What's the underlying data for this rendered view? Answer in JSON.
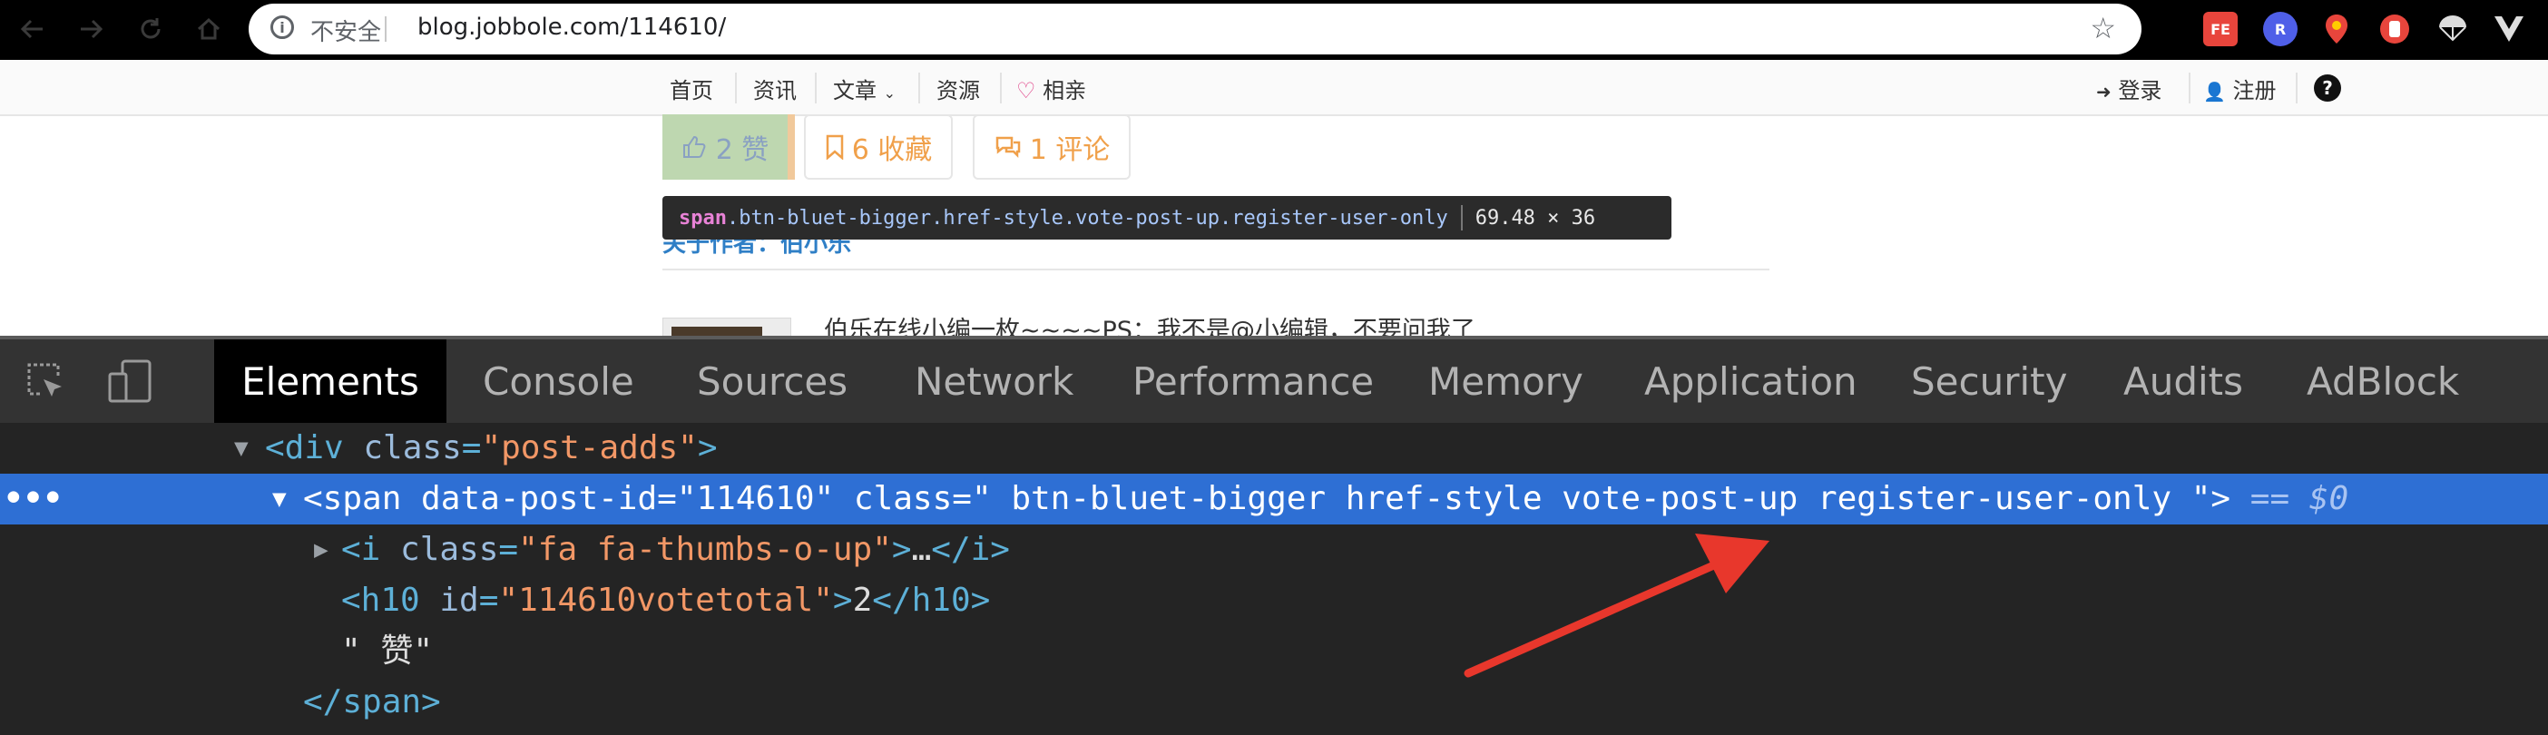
{
  "browser": {
    "nav_icons": [
      "back-icon",
      "forward-icon",
      "reload-icon",
      "home-icon"
    ],
    "security_label": "不安全",
    "url": "blog.jobbole.com/114610/",
    "extensions": [
      {
        "name": "fe-extension-icon",
        "label": "FE",
        "color": "#e8453c"
      },
      {
        "name": "r-extension-icon",
        "label": "R",
        "color": "#4f5fe8"
      },
      {
        "name": "map-pin-extension-icon",
        "label": "",
        "color": "#e8453c"
      },
      {
        "name": "hand-extension-icon",
        "label": "",
        "color": "#e8453c"
      },
      {
        "name": "parachute-extension-icon",
        "label": "",
        "color": "#000000"
      },
      {
        "name": "vue-extension-icon",
        "label": "",
        "color": "#000000"
      }
    ]
  },
  "site_nav": {
    "items": [
      "首页",
      "资讯",
      "文章",
      "资源",
      "相亲"
    ],
    "login": "登录",
    "register": "注册"
  },
  "post": {
    "vote_count": "2 赞",
    "favorite_count": "6 收藏",
    "comment_count": "1 评论",
    "about_author": "关于作者：伯小乐",
    "author_bio": "伯乐在线小编一枚~~~~PS：我不是@小编辑，不要问我了"
  },
  "inspect_tooltip": {
    "tag": "span",
    "classes": ".btn-bluet-bigger.href-style.vote-post-up.register-user-only",
    "size": "69.48 × 36"
  },
  "devtools": {
    "tabs": [
      "Elements",
      "Console",
      "Sources",
      "Network",
      "Performance",
      "Memory",
      "Application",
      "Security",
      "Audits",
      "AdBlock"
    ],
    "active_tab": "Elements",
    "code_lines": [
      {
        "tokens": [
          [
            "tag",
            "<div "
          ],
          [
            "attr",
            "class"
          ],
          [
            "tag",
            "="
          ],
          [
            "val",
            "\"post-adds\""
          ],
          [
            "tag",
            ">"
          ]
        ]
      },
      {
        "tokens": [
          [
            "tag",
            "<span "
          ],
          [
            "attr",
            "data-post-id"
          ],
          [
            "tag",
            "="
          ],
          [
            "val",
            "\"114610\""
          ],
          [
            "tag",
            " "
          ],
          [
            "attr",
            "class"
          ],
          [
            "tag",
            "="
          ],
          [
            "val",
            "\" btn-bluet-bigger href-style vote-post-up   register-user-only \""
          ],
          [
            "tag",
            ">"
          ]
        ],
        "suffix": "== $0"
      },
      {
        "tokens": [
          [
            "tag",
            "<i "
          ],
          [
            "attr",
            "class"
          ],
          [
            "tag",
            "="
          ],
          [
            "val",
            "\"fa  fa-thumbs-o-up\""
          ],
          [
            "tag",
            ">"
          ],
          [
            "txt",
            "…"
          ],
          [
            "tag",
            "</i>"
          ]
        ]
      },
      {
        "tokens": [
          [
            "tag",
            "<h10 "
          ],
          [
            "attr",
            "id"
          ],
          [
            "tag",
            "="
          ],
          [
            "val",
            "\"114610votetotal\""
          ],
          [
            "tag",
            ">"
          ],
          [
            "txt",
            "2"
          ],
          [
            "tag",
            "</h10>"
          ]
        ]
      },
      {
        "tokens": [
          [
            "txt",
            "\" 赞\""
          ]
        ]
      },
      {
        "tokens": [
          [
            "tag",
            "</span>"
          ]
        ]
      }
    ]
  }
}
